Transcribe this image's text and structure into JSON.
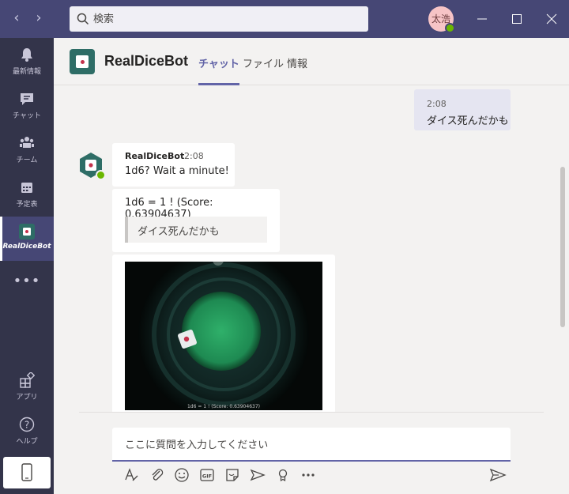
{
  "search": {
    "placeholder": "検索"
  },
  "user": {
    "initials": "太浩"
  },
  "rail": {
    "items": [
      {
        "label": "最新情報"
      },
      {
        "label": "チャット"
      },
      {
        "label": "チーム"
      },
      {
        "label": "予定表"
      },
      {
        "label": "RealDiceBot"
      },
      {
        "label": "アプリ"
      },
      {
        "label": "ヘルプ"
      }
    ]
  },
  "header": {
    "title": "RealDiceBot",
    "tabs": [
      {
        "label": "チャット"
      },
      {
        "label": "ファイル"
      },
      {
        "label": "情報"
      }
    ]
  },
  "messages": {
    "mine": {
      "time": "2:08",
      "text": "ダイス死んだかも"
    },
    "bot_author": "RealDiceBot",
    "bot_time": "2:08",
    "bot_text1": "1d6? Wait a minute!",
    "bot_text2": "1d6 = 1 ! (Score: 0.63904637)",
    "bot_quote": "ダイス死んだかも",
    "image_caption": "1d6 = 1 ! (Score: 0.63904637)"
  },
  "compose": {
    "placeholder": "ここに質問を入力してください"
  },
  "colors": {
    "brand": "#464775",
    "accent": "#6264a7",
    "rail": "#33344a",
    "presence": "#6bb700"
  }
}
